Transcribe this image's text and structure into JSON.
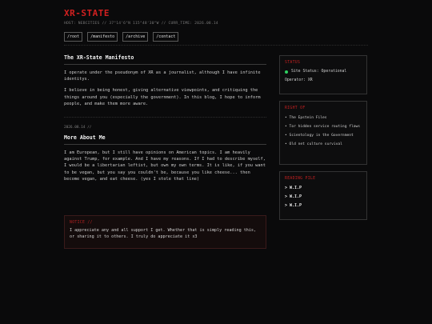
{
  "site": {
    "title": "XR-STATE",
    "host_line": "HOST: NEBCITIES // 37°14'6\"N 115°48'30\"W // CURR_TIME: 2026.08.14"
  },
  "nav": [
    {
      "label": "/root"
    },
    {
      "label": "/manifesto"
    },
    {
      "label": "/archive"
    },
    {
      "label": "/contact"
    }
  ],
  "manifesto": {
    "title": "The XR-State Manifesto",
    "paragraphs": [
      "I operate under the pseudonym of XR as a journalist, although I have infinite identitys.",
      "I believe in being honest, giving alternative viewpoints, and critiquing the things around you (especially the government). In this blog, I hope to inform people, and make them more aware."
    ]
  },
  "post": {
    "date": "2026.08.14 //",
    "title": "More About Me",
    "body": "I am European, but I still have opinions on American topics. I am heavily against Trump, for example. And I have my reasons. If I had to describe myself, I would be a libertarian leftist, but own my own terms. It is like, if you want to be vegan, but you say you couldn't be, because you like cheese... then become vegan, and eat cheese. (yes I stole that line)"
  },
  "notice": {
    "title": "NOTICE //",
    "text": "I appreciate any and all support I get. Whether that is simply reading this, or sharing it to others. I truly do appreciate it x3"
  },
  "sidebar": {
    "status": {
      "title": "STATUS",
      "site_status": "Site Status: Operational",
      "operator": "Operator: XR",
      "status_color": "#2fd060"
    },
    "right_of": {
      "title": "RIGHT OF",
      "items": [
        "The Epstein Files",
        "Tor hidden service routing flaws",
        "Scientology in the Government",
        "Old net culture survival"
      ]
    },
    "reading": {
      "title": "READING PILE",
      "items": [
        ">  W.I.P",
        ">  W.I.P",
        ">  W.I.P"
      ]
    }
  },
  "colors": {
    "accent": "#d22020",
    "background": "#0a0a0b"
  }
}
